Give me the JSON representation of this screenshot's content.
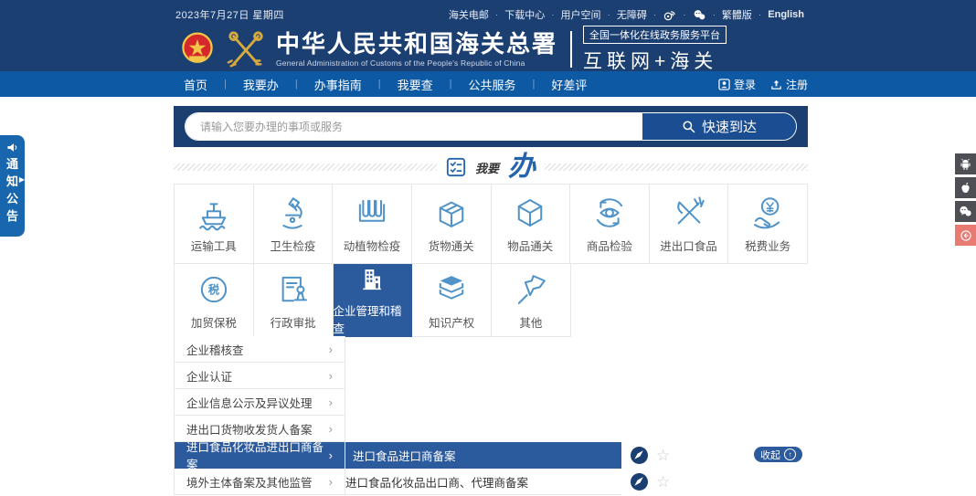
{
  "colors": {
    "header_navy": "#1c3f72",
    "nav_blue": "#0e59a4",
    "accent_selected": "#2b5a9d",
    "icon_blue": "#4f93c8",
    "notice_tab_blue": "#1766ae",
    "float_red": "#e87a72"
  },
  "topbar": {
    "date": "2023年7月27日 星期四",
    "links": [
      {
        "label": "海关电邮"
      },
      {
        "label": "下载中心"
      },
      {
        "label": "用户空间"
      },
      {
        "label": "无障碍"
      }
    ],
    "icons": [
      "weibo-icon",
      "wechat-icon"
    ],
    "lang": [
      {
        "label": "繁體版"
      },
      {
        "label": "English"
      }
    ]
  },
  "header": {
    "title_cn": "中华人民共和国海关总署",
    "title_en": "General Administration of Customs of the People's Republic of China",
    "platform_badge": "全国一体化在线政务服务平台",
    "platform_name": "互联网+海关"
  },
  "nav": {
    "items": [
      {
        "label": "首页"
      },
      {
        "label": "我要办"
      },
      {
        "label": "办事指南"
      },
      {
        "label": "我要查"
      },
      {
        "label": "公共服务"
      },
      {
        "label": "好差评"
      }
    ],
    "login": "登录",
    "register": "注册"
  },
  "search": {
    "placeholder": "请输入您要办理的事项或服务",
    "button_label": "快速到达",
    "button_icon": "search-icon"
  },
  "section": {
    "icon": "checklist-icon",
    "prefix": "我要",
    "main": "办"
  },
  "categories": {
    "row1": [
      {
        "label": "运输工具",
        "icon": "ship-icon"
      },
      {
        "label": "卫生检疫",
        "icon": "microscope-icon"
      },
      {
        "label": "动植物检疫",
        "icon": "test-tubes-icon"
      },
      {
        "label": "货物通关",
        "icon": "package-icon"
      },
      {
        "label": "物品通关",
        "icon": "cube-icon"
      },
      {
        "label": "商品检验",
        "icon": "inspection-eye-icon"
      },
      {
        "label": "进出口食品",
        "icon": "utensils-icon"
      },
      {
        "label": "税费业务",
        "icon": "tax-hand-icon"
      }
    ],
    "row2": [
      {
        "label": "加贸保税",
        "icon": "tax-circle-icon",
        "selected": false
      },
      {
        "label": "行政审批",
        "icon": "approval-doc-icon",
        "selected": false
      },
      {
        "label": "企业管理和稽查",
        "icon": "building-icon",
        "selected": true
      },
      {
        "label": "知识产权",
        "icon": "books-icon",
        "selected": false
      },
      {
        "label": "其他",
        "icon": "pin-icon",
        "selected": false
      }
    ]
  },
  "submenu": [
    {
      "label": "企业稽核查",
      "selected": false
    },
    {
      "label": "企业认证",
      "selected": false
    },
    {
      "label": "企业信息公示及异议处理",
      "selected": false
    },
    {
      "label": "进出口货物收发货人备案",
      "selected": false
    },
    {
      "label": "进口食品化妆品进出口商备案",
      "selected": true
    },
    {
      "label": "境外主体备案及其他监管",
      "selected": false
    }
  ],
  "services": {
    "rows": [
      {
        "label": "进口食品进口商备案",
        "highlighted": true,
        "icons": [
          "compass-icon",
          "star-icon"
        ]
      },
      {
        "label": "进口食品化妆品出口商、代理商备案",
        "highlighted": false,
        "icons": [
          "compass-icon",
          "star-icon"
        ]
      }
    ],
    "collapse_label": "收起",
    "star_glyph": "☆"
  },
  "notice_tab": {
    "label": "通知公告",
    "icon": "speaker-icon"
  },
  "float_right": [
    "android-icon",
    "apple-icon",
    "wechat-icon",
    "back-icon"
  ]
}
